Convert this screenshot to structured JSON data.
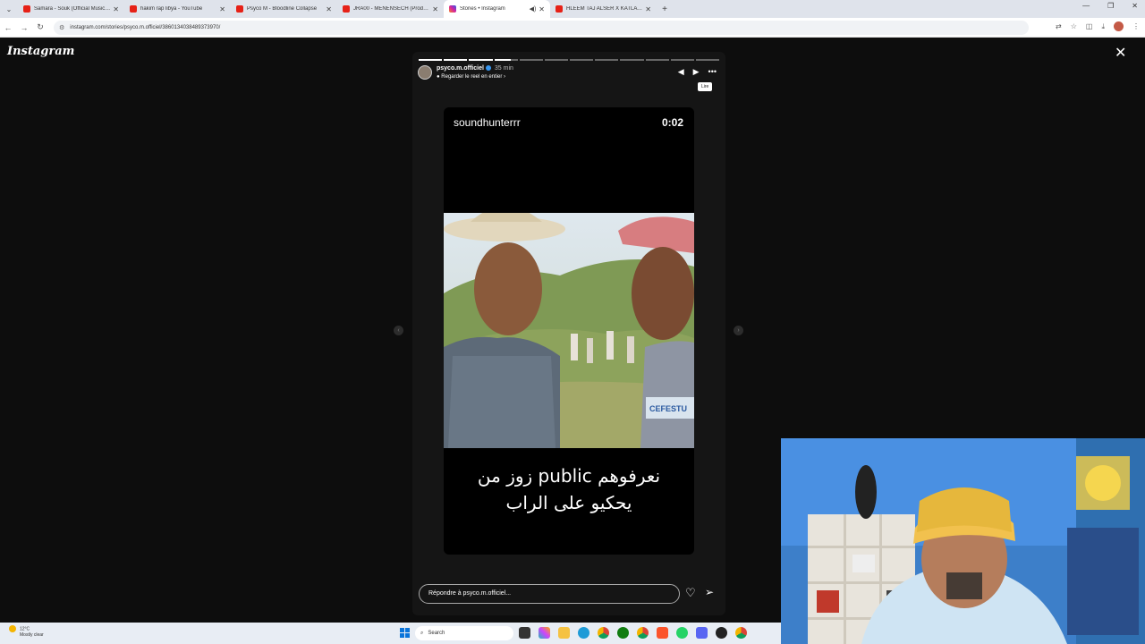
{
  "browser": {
    "tabs": [
      {
        "title": "Samara - Souk (Official Music Vi",
        "color": "#e62117",
        "active": false
      },
      {
        "title": "hakim rap libya - YouTube",
        "color": "#e62117",
        "active": false
      },
      {
        "title": "Psyco M - Bloodline Collapse",
        "color": "#e62117",
        "active": false
      },
      {
        "title": "JRA00 - MENENSECH (Prod. Hz",
        "color": "#e62117",
        "active": false
      },
      {
        "title": "Stories • Instagram",
        "color": "#d6249f",
        "active": true
      },
      {
        "title": "HLEEM TAJ ALSER X KATLA - B",
        "color": "#e62117",
        "active": false
      }
    ],
    "url": "instagram.com/stories/psyco.m.officiel/3860134038489373970/"
  },
  "instagram": {
    "logo": "Instagram",
    "story": {
      "username": "psyco.m.officiel",
      "time": "35 min",
      "reel_link": "Regarder le reel en entier",
      "tooltip": "Lire",
      "progress_total": 12,
      "progress_done": 3,
      "progress_partial": 0.7
    },
    "reel": {
      "username": "soundhunterrr",
      "timestamp": "0:02",
      "caption_line1": "زوز من public نعرفوهم",
      "caption_line2": "يحكيو على الراب",
      "watermark": "CEFESTU"
    },
    "reply_placeholder": "Répondre à psyco.m.officiel..."
  },
  "taskbar": {
    "weather_temp": "12°C",
    "weather_desc": "Mostly clear",
    "search_label": "Search"
  }
}
